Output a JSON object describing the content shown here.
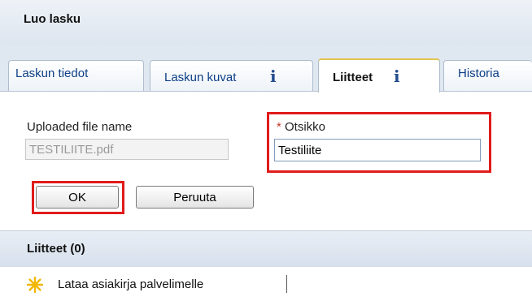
{
  "header": {
    "title": "Luo lasku"
  },
  "tabs": [
    {
      "label": "Laskun tiedot",
      "info_icon": false
    },
    {
      "label": "Laskun kuvat",
      "info_icon": true,
      "info_glyph": "i"
    },
    {
      "label": "Liitteet",
      "info_icon": true,
      "info_glyph": "i",
      "active": true
    },
    {
      "label": "Historia",
      "info_icon": false
    }
  ],
  "form": {
    "file_label": "Uploaded file name",
    "file_value": "TESTILIITE.pdf",
    "title_required_mark": "*",
    "title_label": "Otsikko",
    "title_value": "Testiliite",
    "ok_label": "OK",
    "cancel_label": "Peruuta"
  },
  "attachments": {
    "header": "Liitteet (0)",
    "upload_label": "Lataa asiakirja palvelimelle",
    "upload_icon": "sun-icon"
  },
  "colors": {
    "highlight": "#e11b1b",
    "tab_active_accent": "#e2c34d",
    "link": "#0d3e86",
    "upload_icon": "#f2b705"
  }
}
